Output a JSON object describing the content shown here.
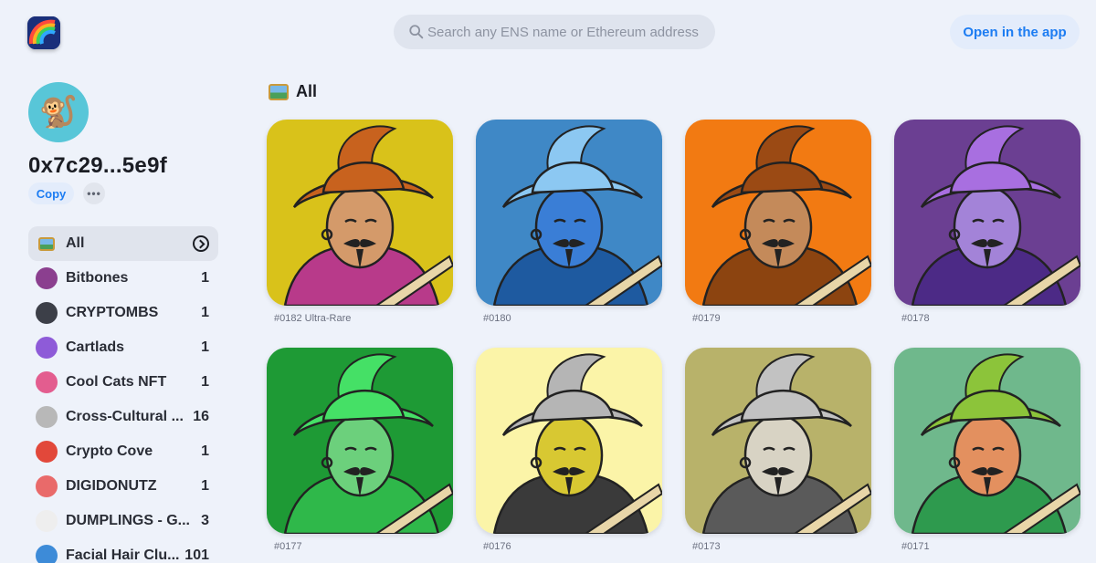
{
  "header": {
    "logo_icon": "rainbow-logo-icon",
    "search_placeholder": "Search any ENS name or Ethereum address",
    "open_app_label": "Open in the app"
  },
  "profile": {
    "avatar_emoji": "🐒",
    "avatar_bg": "#58c6d8",
    "address": "0x7c29...5e9f",
    "copy_label": "Copy",
    "more_label": "•••"
  },
  "sidebar": {
    "items": [
      {
        "label": "All",
        "count": "",
        "icon": "picture-icon",
        "active": true
      },
      {
        "label": "Bitbones",
        "count": "1",
        "icon": "bitbones-avatar",
        "color": "#8b3f8f"
      },
      {
        "label": "CRYPTOMBS",
        "count": "1",
        "icon": "cryptombs-avatar",
        "color": "#3c3f48"
      },
      {
        "label": "Cartlads",
        "count": "1",
        "icon": "cartlads-avatar",
        "color": "#8e5bd8"
      },
      {
        "label": "Cool Cats NFT",
        "count": "1",
        "icon": "coolcats-avatar",
        "color": "#e35d8f"
      },
      {
        "label": "Cross-Cultural ...",
        "count": "16",
        "icon": "ccc-avatar",
        "color": "#b8b8b8"
      },
      {
        "label": "Crypto Cove",
        "count": "1",
        "icon": "cryptocove-avatar",
        "color": "#e2483a"
      },
      {
        "label": "DIGIDONUTZ",
        "count": "1",
        "icon": "digidonutz-avatar",
        "color": "#e96a6a"
      },
      {
        "label": "DUMPLINGS - G...",
        "count": "3",
        "icon": "dumplings-avatar",
        "color": "#eeeeee"
      },
      {
        "label": "Facial Hair Clu...",
        "count": "101",
        "icon": "facialhair-avatar",
        "color": "#3d8bd8"
      }
    ]
  },
  "main": {
    "section_title": "All",
    "cards": [
      {
        "caption": "#0182 Ultra-Rare",
        "bg": "#d9c21a",
        "hat": "#c8621e",
        "face": "#d49a6a",
        "coat": "#b83a8a"
      },
      {
        "caption": "#0180",
        "bg": "#3f88c6",
        "hat": "#8cc8f2",
        "face": "#3a7ed6",
        "coat": "#1e5aa0"
      },
      {
        "caption": "#0179",
        "bg": "#f27a12",
        "hat": "#9b4a14",
        "face": "#c48a5a",
        "coat": "#8c4410"
      },
      {
        "caption": "#0178",
        "bg": "#6b3f92",
        "hat": "#a86fe0",
        "face": "#a383d8",
        "coat": "#4c2a86"
      },
      {
        "caption": "#0177",
        "bg": "#1e9a35",
        "hat": "#45e066",
        "face": "#6cd07c",
        "coat": "#2fb84a"
      },
      {
        "caption": "#0176",
        "bg": "#fbf4a8",
        "hat": "#b5b5b5",
        "face": "#d8c832",
        "coat": "#3a3a3a"
      },
      {
        "caption": "#0173",
        "bg": "#b8b26a",
        "hat": "#c2c2c2",
        "face": "#d8d3c4",
        "coat": "#5a5a5a"
      },
      {
        "caption": "#0171",
        "bg": "#6fb88c",
        "hat": "#8cc43a",
        "face": "#e3905f",
        "coat": "#2e9a4e"
      }
    ]
  }
}
